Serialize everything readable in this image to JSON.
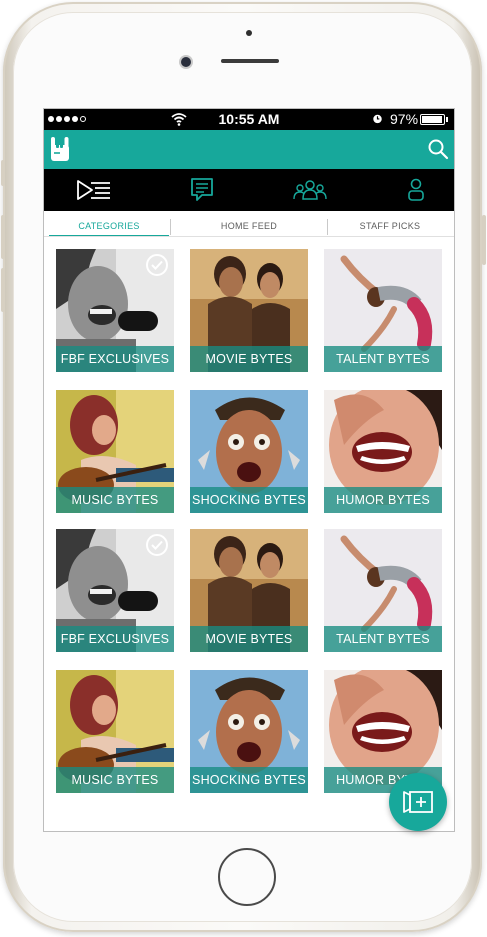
{
  "status_bar": {
    "time": "10:55 AM",
    "battery_percent": "97%",
    "battery_level": 0.97
  },
  "app_bar": {
    "logo_icon": "rock-hand-logo-icon",
    "search_icon": "search-icon",
    "color": "#17a89b"
  },
  "icon_bar": [
    {
      "icon": "playlist-icon",
      "active": false
    },
    {
      "icon": "chat-icon",
      "active": true
    },
    {
      "icon": "group-icon",
      "active": true
    },
    {
      "icon": "profile-icon",
      "active": true
    }
  ],
  "tabs": [
    {
      "label": "CATEGORIES",
      "active": true
    },
    {
      "label": "HOME FEED",
      "active": false
    },
    {
      "label": "STAFF PICKS",
      "active": false
    }
  ],
  "categories": [
    {
      "label": "FBF EXCLUSIVES",
      "checked": true
    },
    {
      "label": "MOVIE BYTES",
      "checked": false
    },
    {
      "label": "TALENT BYTES",
      "checked": false
    },
    {
      "label": "MUSIC BYTES",
      "checked": false
    },
    {
      "label": "SHOCKING BYTES",
      "checked": false
    },
    {
      "label": "HUMOR BYTES",
      "checked": false
    },
    {
      "label": "FBF EXCLUSIVES",
      "checked": true
    },
    {
      "label": "MOVIE BYTES",
      "checked": false
    },
    {
      "label": "TALENT BYTES",
      "checked": false
    },
    {
      "label": "MUSIC BYTES",
      "checked": false
    },
    {
      "label": "SHOCKING BYTES",
      "checked": false
    },
    {
      "label": "HUMOR BYTES",
      "checked": false
    }
  ],
  "fab": {
    "icon": "add-video-icon"
  }
}
